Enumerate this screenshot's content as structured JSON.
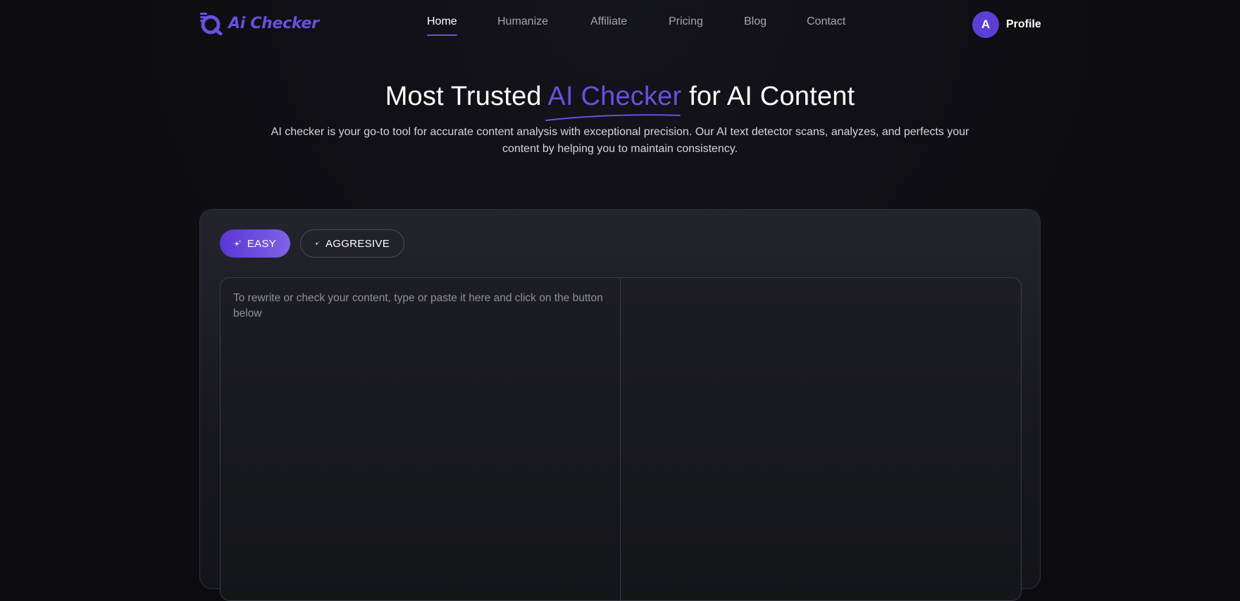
{
  "brand": {
    "name": "Ai Checker",
    "accent": "#6b4fe0"
  },
  "nav": {
    "links": [
      {
        "label": "Home",
        "active": true
      },
      {
        "label": "Humanize",
        "active": false
      },
      {
        "label": "Affiliate",
        "active": false
      },
      {
        "label": "Pricing",
        "active": false
      },
      {
        "label": "Blog",
        "active": false
      },
      {
        "label": "Contact",
        "active": false
      }
    ],
    "profile": {
      "initial": "A",
      "label": "Profile"
    }
  },
  "hero": {
    "title_before": "Most Trusted ",
    "title_accent": "AI Checker",
    "title_after": " for AI Content",
    "subtitle": "AI checker is your go-to tool for accurate content analysis with exceptional precision. Our AI text detector scans, analyzes, and perfects your content by helping you to maintain consistency."
  },
  "tool": {
    "modes": [
      {
        "label": "EASY",
        "icon": "sparkle-icon",
        "selected": true
      },
      {
        "label": "AGGRESIVE",
        "icon": "sparkle-icon",
        "selected": false
      }
    ],
    "input": {
      "placeholder": "To rewrite or check your content, type or paste it here and click on the button below",
      "value": ""
    },
    "output": {
      "value": ""
    }
  }
}
